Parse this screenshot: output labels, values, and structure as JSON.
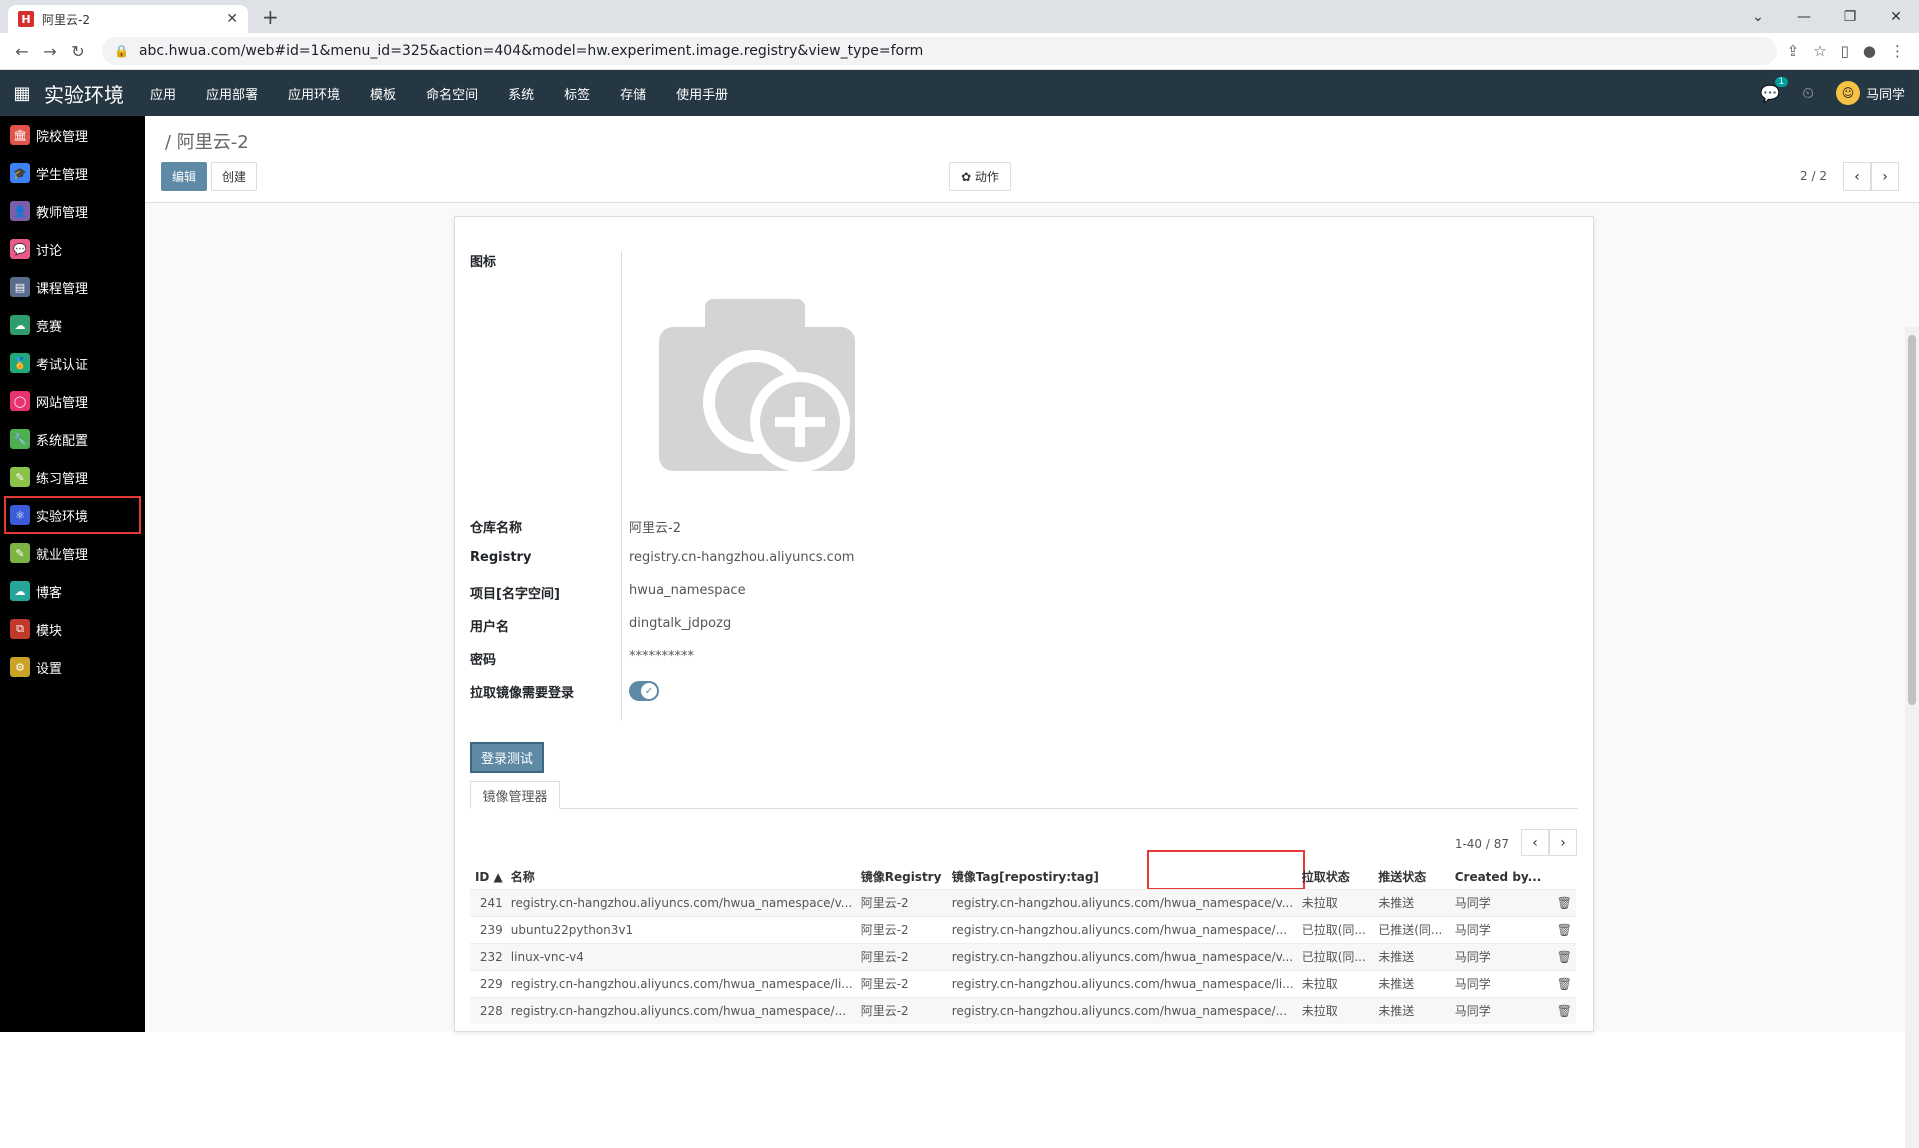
{
  "browser": {
    "tab_title": "阿里云-2",
    "favicon_letter": "H",
    "url": "abc.hwua.com/web#id=1&menu_id=325&action=404&model=hw.experiment.image.registry&view_type=form",
    "icons": [
      "back-icon",
      "forward-icon",
      "reload-icon",
      "share-icon",
      "star-icon",
      "sidebar-icon",
      "profile-icon",
      "menu-icon"
    ]
  },
  "app": {
    "brand": "实验环境",
    "menu": [
      "应用",
      "应用部署",
      "应用环境",
      "模板",
      "命名空间",
      "系统",
      "标签",
      "存储",
      "使用手册"
    ],
    "chat_badge": "1",
    "user": "马同学"
  },
  "sidebar": [
    {
      "label": "院校管理",
      "color": "#e0524a"
    },
    {
      "label": "学生管理",
      "color": "#3b82f6"
    },
    {
      "label": "教师管理",
      "color": "#7b5ea7"
    },
    {
      "label": "讨论",
      "color": "#e95a8c"
    },
    {
      "label": "课程管理",
      "color": "#5b6b8c"
    },
    {
      "label": "竞赛",
      "color": "#2e9c6c"
    },
    {
      "label": "考试认证",
      "color": "#1fa87a"
    },
    {
      "label": "网站管理",
      "color": "#e8336f"
    },
    {
      "label": "系统配置",
      "color": "#4caf50"
    },
    {
      "label": "练习管理",
      "color": "#8bc34a"
    },
    {
      "label": "实验环境",
      "color": "#3b5bdb",
      "highlight": true
    },
    {
      "label": "就业管理",
      "color": "#7cb342"
    },
    {
      "label": "博客",
      "color": "#26a69a"
    },
    {
      "label": "模块",
      "color": "#c0392b"
    },
    {
      "label": "设置",
      "color": "#c9a227"
    }
  ],
  "control": {
    "breadcrumb": "/ 阿里云-2",
    "edit": "编辑",
    "create": "创建",
    "action": "✿ 动作",
    "pager": "2 / 2"
  },
  "form": {
    "icon_label": "图标",
    "fields": [
      {
        "label": "仓库名称",
        "value": "阿里云-2"
      },
      {
        "label": "Registry",
        "value": "registry.cn-hangzhou.aliyuncs.com"
      },
      {
        "label": "项目[名字空间]",
        "value": "hwua_namespace"
      },
      {
        "label": "用户名",
        "value": "dingtalk_jdpozg"
      },
      {
        "label": "密码",
        "value": "**********"
      },
      {
        "label": "拉取镜像需要登录",
        "value": ""
      }
    ],
    "login_test": "登录测试",
    "tab": "镜像管理器",
    "list_pager": "1-40 / 87"
  },
  "table": {
    "headers": [
      "ID ▲",
      "名称",
      "镜像Registry",
      "镜像Tag[repostiry:tag]",
      "拉取状态",
      "推送状态",
      "Created by..."
    ],
    "rows": [
      [
        "241",
        "registry.cn-hangzhou.aliyuncs.com/hwua_namespace/v...",
        "阿里云-2",
        "registry.cn-hangzhou.aliyuncs.com/hwua_namespace/v...",
        "未拉取",
        "未推送",
        "马同学"
      ],
      [
        "239",
        "ubuntu22python3v1",
        "阿里云-2",
        "registry.cn-hangzhou.aliyuncs.com/hwua_namespace/...",
        "已拉取(同...",
        "已推送(同...",
        "马同学"
      ],
      [
        "232",
        "linux-vnc-v4",
        "阿里云-2",
        "registry.cn-hangzhou.aliyuncs.com/hwua_namespace/v...",
        "已拉取(同...",
        "未推送",
        "马同学"
      ],
      [
        "229",
        "registry.cn-hangzhou.aliyuncs.com/hwua_namespace/li...",
        "阿里云-2",
        "registry.cn-hangzhou.aliyuncs.com/hwua_namespace/li...",
        "未拉取",
        "未推送",
        "马同学"
      ],
      [
        "228",
        "registry.cn-hangzhou.aliyuncs.com/hwua_namespace/...",
        "阿里云-2",
        "registry.cn-hangzhou.aliyuncs.com/hwua_namespace/...",
        "未拉取",
        "未推送",
        "马同学"
      ]
    ]
  }
}
